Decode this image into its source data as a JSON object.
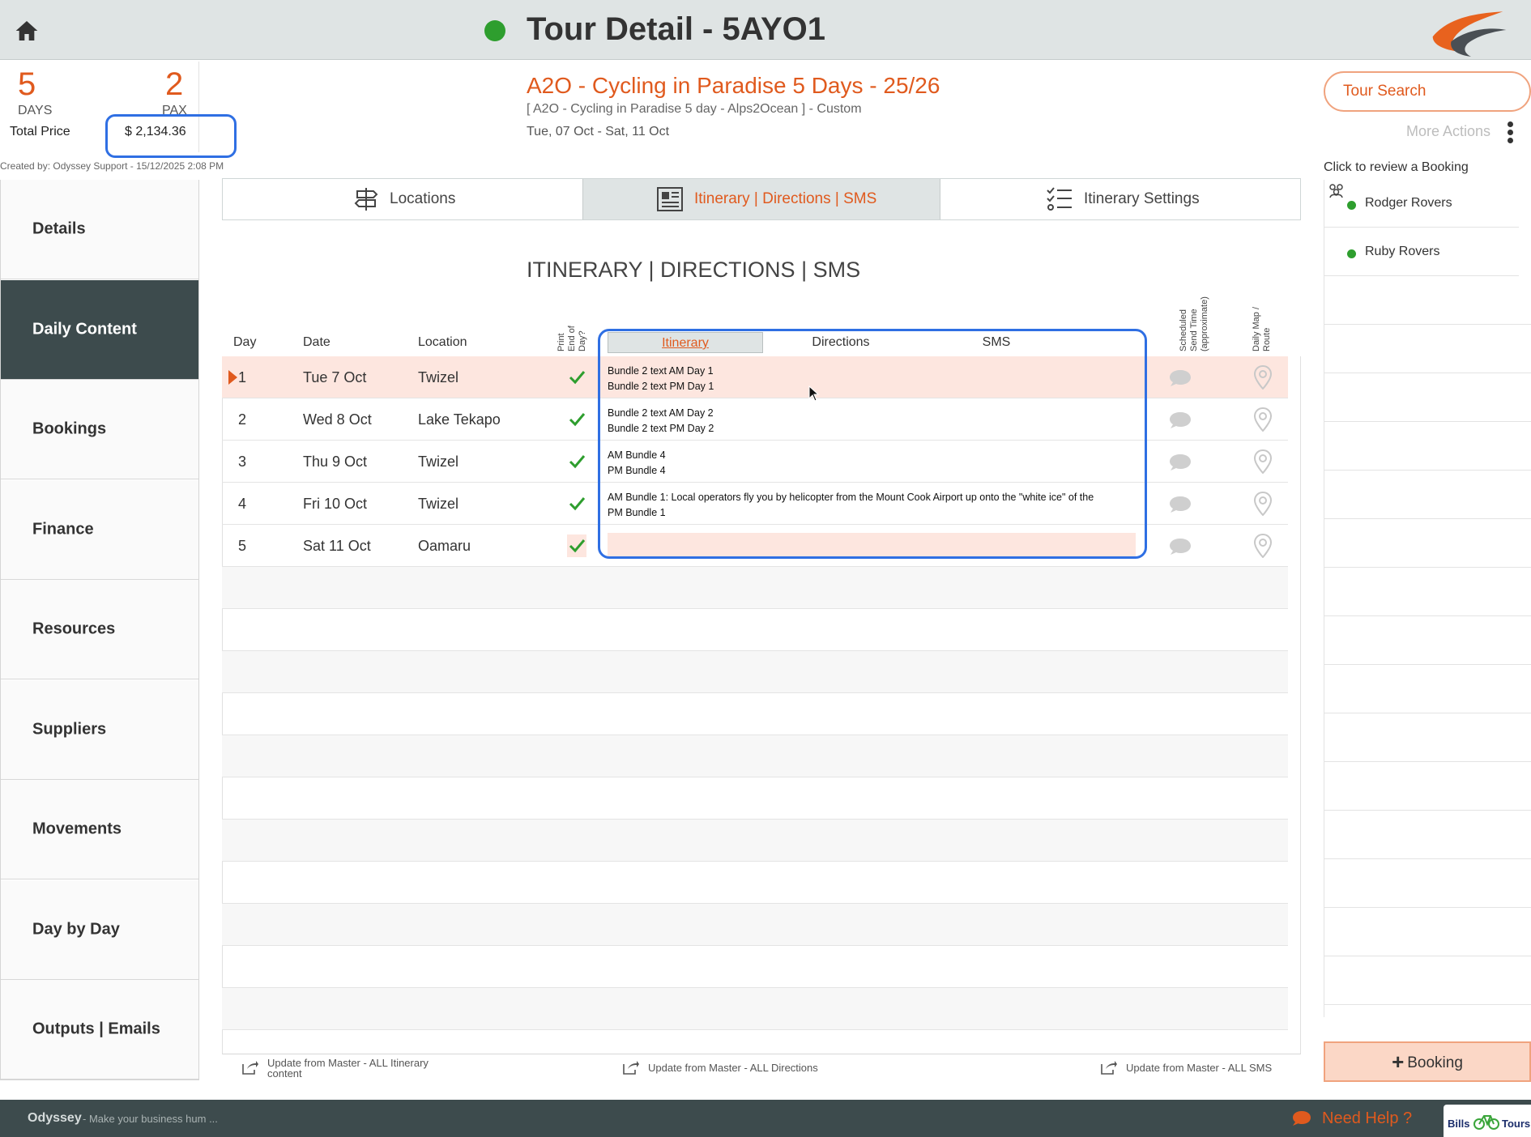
{
  "header": {
    "title": "Tour Detail - 5AYO1",
    "status_color": "#2e9e2e"
  },
  "summary": {
    "days_value": "5",
    "days_label": "DAYS",
    "pax_value": "2",
    "pax_label": "PAX",
    "price_label": "Total Price",
    "price_value": "$ 2,134.36",
    "created_by": "Created by: Odyssey Support - 15/12/2025 2:08 PM"
  },
  "tour": {
    "name": "A2O - Cycling in Paradise 5 Days - 25/26",
    "subtitle": "[ A2O - Cycling in Paradise 5 day - Alps2Ocean ] - Custom",
    "dates": "Tue, 07 Oct  - Sat, 11 Oct"
  },
  "actions": {
    "tour_search_label": "Tour Search",
    "more_actions_label": "More Actions",
    "review_label": "Click to review a Booking",
    "add_booking_label": "Booking"
  },
  "bookings": [
    {
      "name": "Rodger Rovers"
    },
    {
      "name": "Ruby Rovers"
    }
  ],
  "nav": [
    {
      "label": "Details"
    },
    {
      "label": "Daily Content"
    },
    {
      "label": "Bookings"
    },
    {
      "label": "Finance"
    },
    {
      "label": "Resources"
    },
    {
      "label": "Suppliers"
    },
    {
      "label": "Movements"
    },
    {
      "label": "Day by Day"
    },
    {
      "label": "Outputs | Emails"
    }
  ],
  "tabs": [
    {
      "label": "Locations",
      "icon": "signpost-icon"
    },
    {
      "label": "Itinerary | Directions | SMS",
      "icon": "document-icon"
    },
    {
      "label": "Itinerary Settings",
      "icon": "checklist-icon"
    }
  ],
  "section_heading": "ITINERARY | DIRECTIONS | SMS",
  "table": {
    "headers": {
      "day": "Day",
      "date": "Date",
      "location": "Location",
      "print_eod_1": "Print",
      "print_eod_2": "End of",
      "print_eod_3": "Day?",
      "scheduled_1": "Scheduled",
      "scheduled_2": "Send Time",
      "scheduled_3": "(approximate)",
      "map_1": "Daily Map /",
      "map_2": "Route"
    },
    "subtabs": [
      {
        "label": "Itinerary"
      },
      {
        "label": "Directions"
      },
      {
        "label": "SMS"
      }
    ],
    "rows": [
      {
        "day": "1",
        "date": "Tue 7 Oct",
        "location": "Twizel",
        "line1": "Bundle 2 text AM Day 1",
        "line2": "Bundle 2 text PM Day 1"
      },
      {
        "day": "2",
        "date": "Wed 8 Oct",
        "location": "Lake Tekapo",
        "line1": "Bundle 2 text AM Day 2",
        "line2": "Bundle 2 text PM Day 2"
      },
      {
        "day": "3",
        "date": "Thu 9 Oct",
        "location": "Twizel",
        "line1": "AM Bundle 4",
        "line2": "PM Bundle 4"
      },
      {
        "day": "4",
        "date": "Fri 10 Oct",
        "location": "Twizel",
        "line1": "AM Bundle 1: Local operators fly you by helicopter from the Mount Cook Airport up onto the \"white ice\" of the",
        "line2": "PM Bundle 1"
      },
      {
        "day": "5",
        "date": "Sat 11 Oct",
        "location": "Oamaru",
        "line1": "",
        "line2": ""
      }
    ]
  },
  "footer_links": {
    "itinerary": "Update from Master - ALL Itinerary content",
    "directions": "Update from Master - ALL Directions",
    "sms": "Update from Master - ALL SMS"
  },
  "bottombar": {
    "brand": "Odyssey",
    "tagline": "- Make your business hum ...",
    "help": "Need Help ?",
    "badge_left": "Bills",
    "badge_right": "Tours"
  },
  "colors": {
    "accent": "#e05a1e",
    "nav_active": "#3d4b4d",
    "highlight_ring": "#2f6fe3",
    "check": "#2e9e2e"
  }
}
